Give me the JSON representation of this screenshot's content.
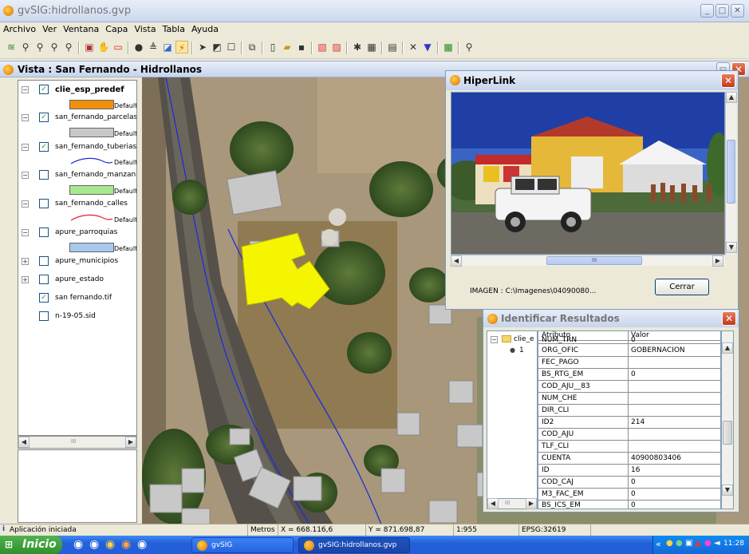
{
  "app": {
    "title": "gvSIG:hidrollanos.gvp"
  },
  "menu": [
    "Archivo",
    "Ver",
    "Ventana",
    "Capa",
    "Vista",
    "Tabla",
    "Ayuda"
  ],
  "toolbar": {
    "icons": [
      "layers-icon",
      "zoom-in-icon",
      "zoom-out-icon",
      "zoom-select-icon",
      "zoom-back-icon",
      "locate-icon",
      "pan-icon",
      "rect-icon",
      "info-icon",
      "measure-icon",
      "area-icon",
      "hyperlink-icon",
      "pointer-icon",
      "select-icon",
      "select-rect-icon",
      "layer-add-icon",
      "new-icon",
      "open-icon",
      "save-icon",
      "print-icon",
      "print-layout-icon",
      "tools-icon",
      "table-icon",
      "props-icon",
      "clear-icon",
      "filter-icon",
      "export-icon",
      "query-icon"
    ]
  },
  "view": {
    "title": "Vista : San Fernando - Hidrollanos"
  },
  "toc": {
    "layers": [
      {
        "name": "clie_esp_predef",
        "checked": true,
        "expand": "−",
        "legend": "Default",
        "color": "#f0900a"
      },
      {
        "name": "san_fernando_parcelas",
        "checked": true,
        "expand": "−",
        "legend": "Default",
        "color": "#c8c8c8"
      },
      {
        "name": "san_fernando_tuberias",
        "checked": true,
        "expand": "−",
        "legend": "Default",
        "color": "#1a2fd8"
      },
      {
        "name": "san_fernando_manzana",
        "checked": false,
        "expand": "−",
        "legend": "Default",
        "color": "#a8e890"
      },
      {
        "name": "san_fernando_calles",
        "checked": false,
        "expand": "−",
        "legend": "Default",
        "color": "#e8202a"
      },
      {
        "name": "apure_parroquias",
        "checked": false,
        "expand": "−",
        "legend": "Default",
        "color": "#a8c8ee"
      },
      {
        "name": "apure_municipios",
        "checked": false,
        "expand": "+"
      },
      {
        "name": "apure_estado",
        "checked": false,
        "expand": "+"
      },
      {
        "name": "san fernando.tif",
        "checked": true,
        "expand": ""
      },
      {
        "name": "n-19-05.sid",
        "checked": false,
        "expand": ""
      }
    ]
  },
  "hyperlink": {
    "title": "HiperLink",
    "image_label": "IMAGEN : C:\\Imagenes\\04090080...",
    "close_label": "Cerrar",
    "scroll_mid": "III"
  },
  "identify": {
    "title": "Identificar Resultados",
    "tree_item": "clie_e",
    "tree_sub": "1",
    "columns": [
      "Atributo",
      "Valor"
    ],
    "rows": [
      [
        "NUM_TRN",
        "0"
      ],
      [
        "ORG_OFIC",
        "GOBERNACION"
      ],
      [
        "FEC_PAGO",
        ""
      ],
      [
        "BS_RTG_EM",
        "0"
      ],
      [
        "COD_AJU__83",
        ""
      ],
      [
        "NUM_CHE",
        ""
      ],
      [
        "DIR_CLI",
        ""
      ],
      [
        "ID2",
        "214"
      ],
      [
        "COD_AJU",
        ""
      ],
      [
        "TLF_CLI",
        ""
      ],
      [
        "CUENTA",
        "40900803406"
      ],
      [
        "ID",
        "16"
      ],
      [
        "COD_CAJ",
        "0"
      ],
      [
        "M3_FAC_EM",
        "0"
      ],
      [
        "BS_ICS_EM",
        "0"
      ]
    ],
    "scroll_mid": "III"
  },
  "status": {
    "message": "Aplicación iniciada",
    "units": "Metros",
    "x": "X = 668.116,6",
    "y": "Y = 871.698,87",
    "scale": "1:955",
    "epsg": "EPSG:32619"
  },
  "taskbar": {
    "start": "Inicio",
    "tasks": [
      "gvSIG",
      "gvSIG:hidrollanos.gvp"
    ],
    "clock": "11:28"
  },
  "toc_scroll_mid": "III"
}
